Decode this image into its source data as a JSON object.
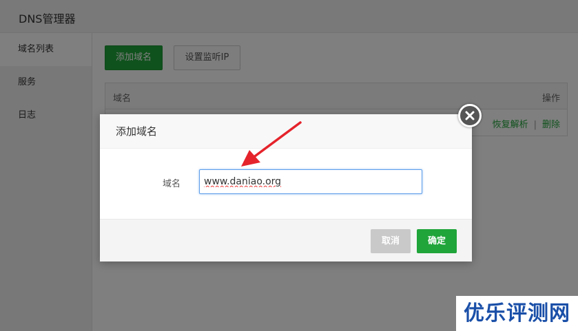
{
  "window": {
    "title": "DNS管理器"
  },
  "sidebar": {
    "items": [
      {
        "label": "域名列表"
      },
      {
        "label": "服务"
      },
      {
        "label": "日志"
      }
    ]
  },
  "toolbar": {
    "add_domain_label": "添加域名",
    "set_ip_label": "设置监听IP"
  },
  "table": {
    "headers": [
      "域名",
      "操作"
    ],
    "row_actions": {
      "restore": "恢复解析",
      "separator": "|",
      "delete": "删除"
    }
  },
  "dialog": {
    "title": "添加域名",
    "field_label": "域名",
    "field_value": "www.daniao.org",
    "cancel_label": "取消",
    "ok_label": "确定"
  },
  "watermark": {
    "text": "优乐评测网"
  },
  "colors": {
    "accent": "#20a53a",
    "arrow": "#e5232b",
    "watermark": "#1a4fa8"
  },
  "icons": {
    "close": "close-circle-icon",
    "arrow": "red-arrow-annotation"
  }
}
